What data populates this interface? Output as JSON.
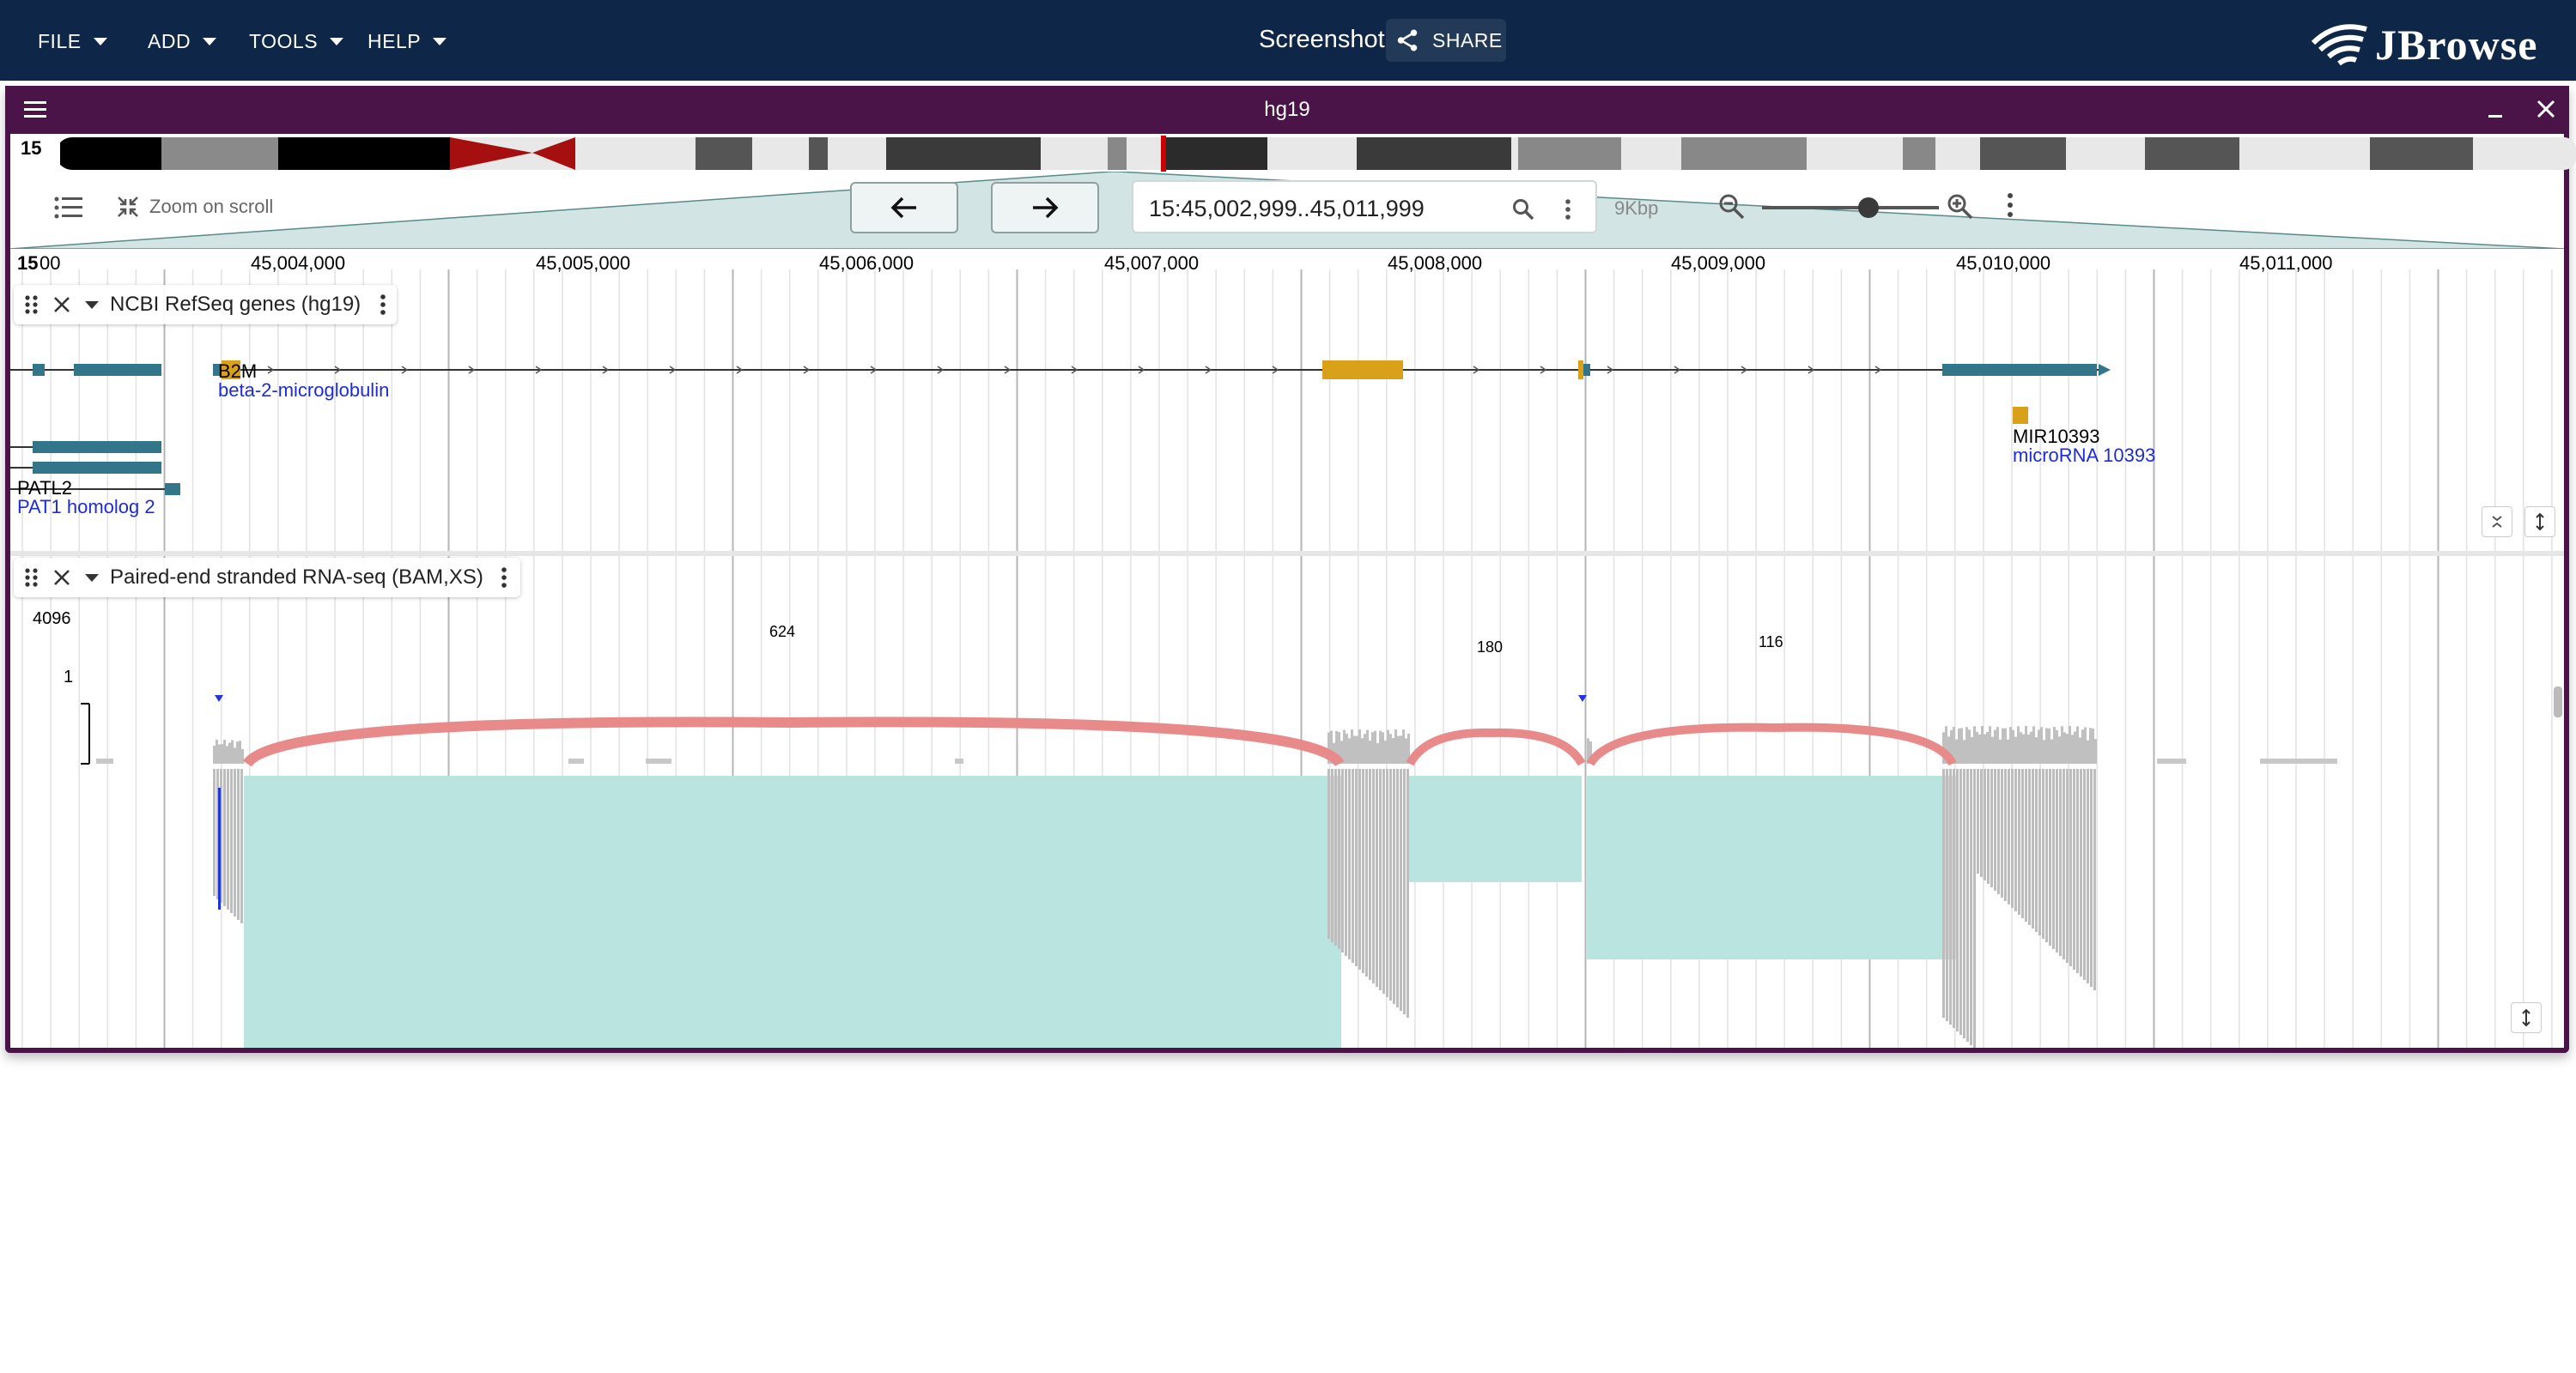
{
  "menu": {
    "file": "FILE",
    "add": "ADD",
    "tools": "TOOLS",
    "help": "HELP"
  },
  "session": {
    "title": "Screenshot",
    "share_label": "SHARE"
  },
  "logo": {
    "text": "JBrowse"
  },
  "view": {
    "assembly": "hg19",
    "chromosome": "15",
    "zoom_on_scroll": "Zoom on scroll",
    "locstring": "15:45,002,999..45,011,999",
    "width_label": "9Kbp"
  },
  "ruler": {
    "start_label": "15",
    "partial_label": "00",
    "ticks": [
      "45,004,000",
      "45,005,000",
      "45,006,000",
      "45,007,000",
      "45,008,000",
      "45,009,000",
      "45,010,000",
      "45,011,000"
    ]
  },
  "tracks": {
    "genes": {
      "name": "NCBI RefSeq genes (hg19)",
      "features": [
        {
          "name": "B2M",
          "description": "beta-2-microglobulin"
        },
        {
          "name": "MIR10393",
          "description": "microRNA 10393"
        },
        {
          "name": "PATL2",
          "description": "PAT1 homolog 2"
        }
      ]
    },
    "rnaseq": {
      "name": "Paired-end stranded RNA-seq (BAM,XS)",
      "scale_max": "4096",
      "scale_min": "1",
      "junctions": [
        {
          "count": "624"
        },
        {
          "count": "180"
        },
        {
          "count": "116"
        }
      ]
    }
  },
  "colors": {
    "appbar": "#0e2647",
    "view_header": "#4a1449",
    "utr": "#d9a01a",
    "cds": "#33768a",
    "junction": "#e88a8a",
    "read_gap": "#b9e4df",
    "coverage": "#c0c0c0"
  }
}
